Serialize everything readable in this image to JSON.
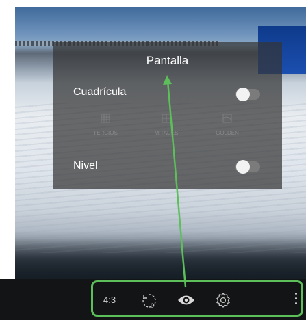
{
  "panel": {
    "title": "Pantalla",
    "grid": {
      "label": "Cuadrícula",
      "enabled": false
    },
    "grid_options": [
      {
        "label": "TERCIOS",
        "icon": "grid-thirds-icon"
      },
      {
        "label": "MITADES",
        "icon": "grid-halves-icon"
      },
      {
        "label": "GOLDEN",
        "icon": "golden-ratio-icon"
      }
    ],
    "level": {
      "label": "Nivel",
      "enabled": false
    }
  },
  "toolbar": {
    "aspect_ratio": "4:3",
    "timer_value": "0",
    "icons": [
      "timer-icon",
      "eye-icon",
      "settings-icon",
      "more-vertical-icon"
    ]
  },
  "annotation": {
    "highlight_color": "#5cbf5a"
  }
}
